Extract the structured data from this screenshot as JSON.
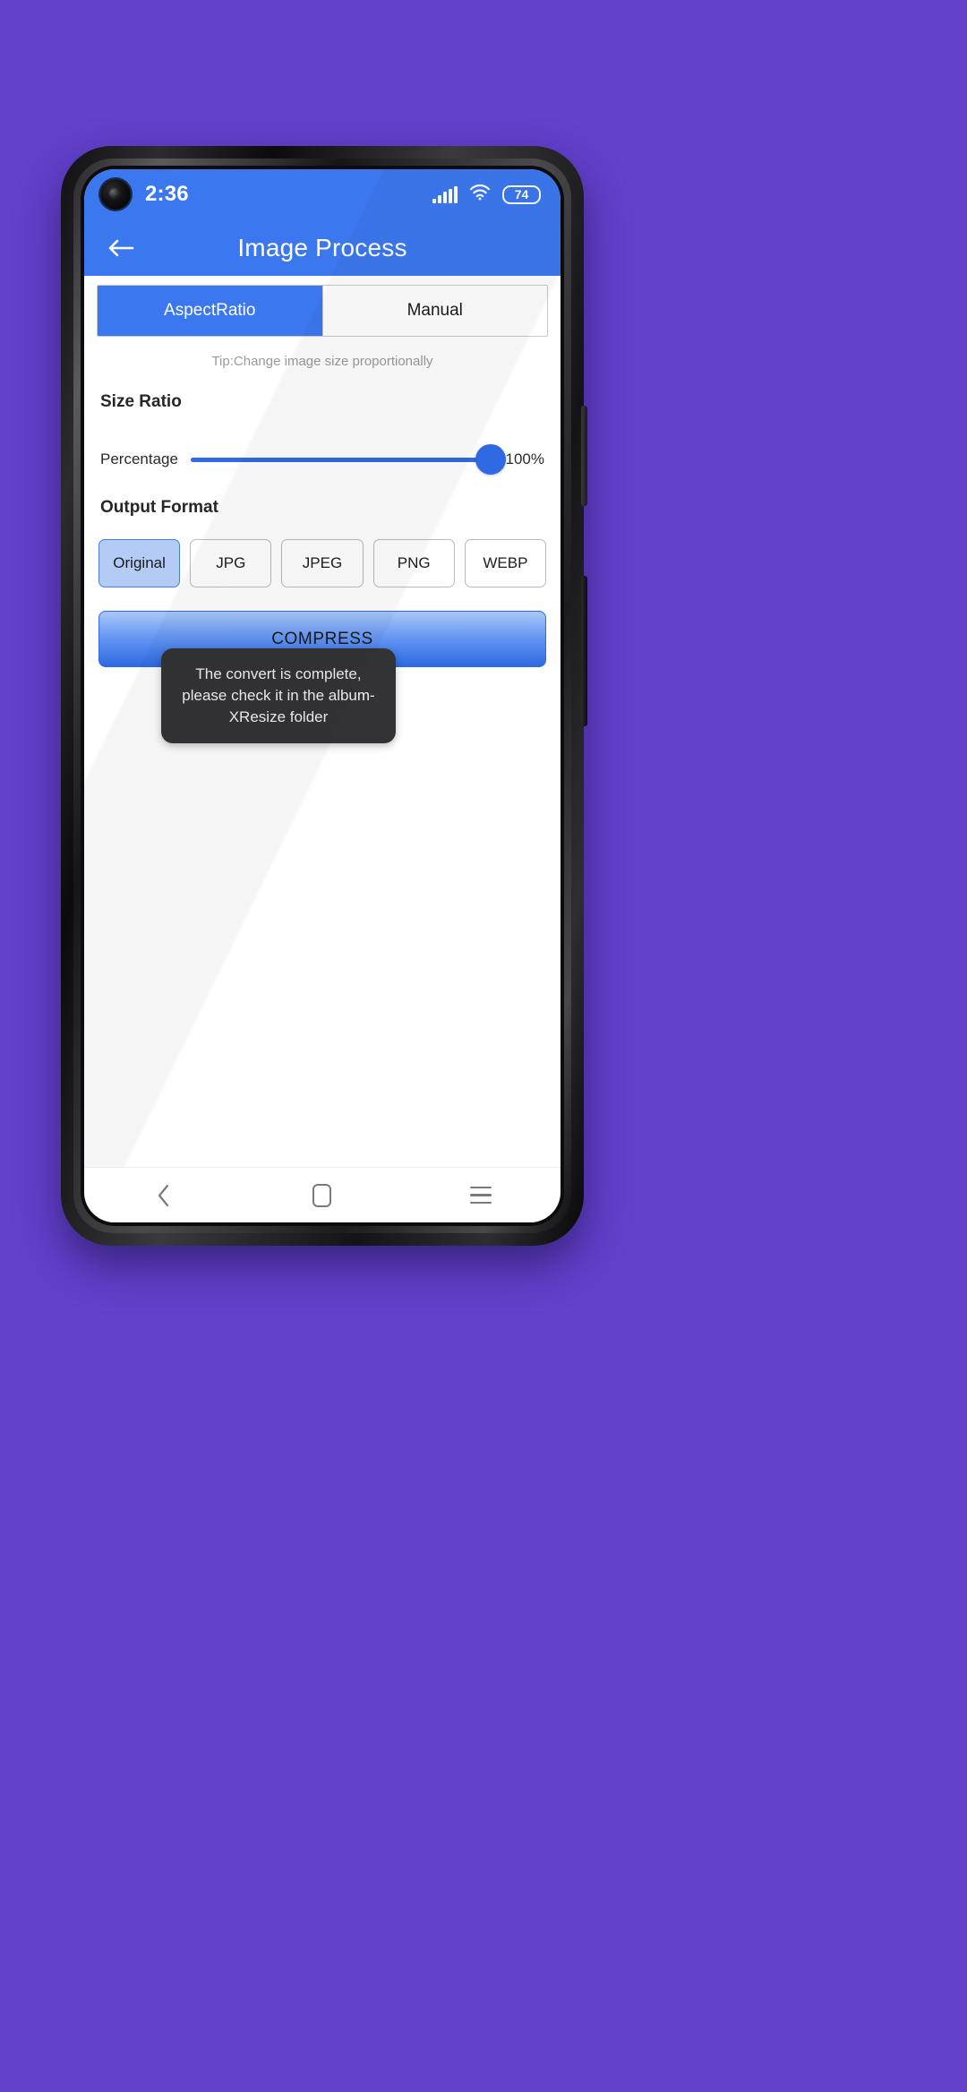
{
  "background": {
    "color": "#6241CB"
  },
  "device": {
    "name": "android-phone",
    "buttons": {
      "volume": "volume-rocker",
      "power": "power-button"
    },
    "camera": "punch-hole-camera"
  },
  "status_bar": {
    "time": "2:36",
    "battery_level": "74",
    "icons": [
      "signal-icon",
      "wifi-icon",
      "battery-icon"
    ],
    "background_color": "#3B78F0"
  },
  "app_bar": {
    "title": "Image Process",
    "back_icon": "arrow-left-icon",
    "background_color": "#3B78F0"
  },
  "tabs": [
    {
      "label": "AspectRatio",
      "active": true
    },
    {
      "label": "Manual",
      "active": false
    }
  ],
  "tip": "Tip:Change image size proportionally",
  "size_ratio": {
    "section_title": "Size Ratio",
    "slider_label": "Percentage",
    "value": 100,
    "value_display": "100%",
    "min": 0,
    "max": 100,
    "accent_color": "#2F6AE2"
  },
  "output_format": {
    "section_title": "Output Format",
    "options": [
      {
        "label": "Original",
        "selected": true
      },
      {
        "label": "JPG",
        "selected": false
      },
      {
        "label": "JPEG",
        "selected": false
      },
      {
        "label": "PNG",
        "selected": false
      },
      {
        "label": "WEBP",
        "selected": false
      }
    ],
    "selected_color": "#B3CBF5"
  },
  "compress_button": {
    "label": "COMPRESS"
  },
  "toast": {
    "message": "The convert is complete, please check it in the album-XResize folder",
    "background_color": "#333335"
  },
  "nav_bar": {
    "back_icon": "chevron-left-icon",
    "home_icon": "home-square-icon",
    "recents_icon": "menu-lines-icon"
  }
}
